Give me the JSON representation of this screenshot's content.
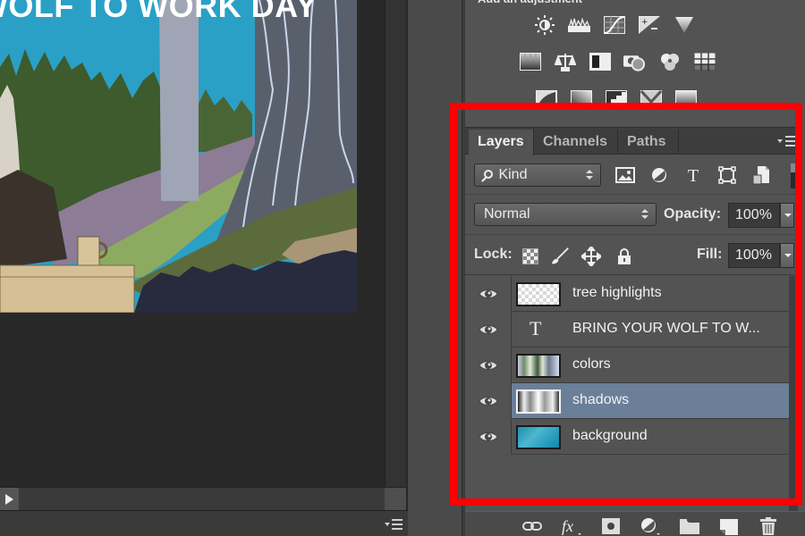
{
  "canvas": {
    "artwork_title": "BRING YOUR WOLF TO WORK DAY",
    "colors": {
      "sky": "#2aa0c6",
      "forest": "#3c5a2c",
      "meadow": "#8fae5f",
      "lilac": "#8a7a94",
      "trunk": "#6b727a",
      "night": "#27283a",
      "paper": "#d8c6a0"
    }
  },
  "status_bar": {
    "menu_icon": "panel-menu-icon"
  },
  "adjustments": {
    "heading": "Add an adjustment",
    "row1": [
      "brightness-contrast-icon",
      "levels-icon",
      "curves-icon",
      "exposure-icon",
      "vibrance-icon"
    ],
    "row2": [
      "hue-saturation-icon",
      "color-balance-icon",
      "black-white-icon",
      "photo-filter-icon",
      "channel-mixer-icon",
      "color-lookup-icon"
    ],
    "row3": [
      "invert-icon",
      "posterize-icon",
      "threshold-icon",
      "selective-color-icon",
      "gradient-map-icon"
    ]
  },
  "layers_panel": {
    "tabs": [
      {
        "label": "Layers",
        "active": true
      },
      {
        "label": "Channels",
        "active": false
      },
      {
        "label": "Paths",
        "active": false
      }
    ],
    "filter": {
      "kind_label": "Kind",
      "icons": [
        "pixel-layer-filter-icon",
        "adjustment-layer-filter-icon",
        "type-layer-filter-icon",
        "shape-layer-filter-icon",
        "smart-object-filter-icon"
      ]
    },
    "blend_mode": "Normal",
    "opacity_label": "Opacity:",
    "opacity_value": "100%",
    "lock_label": "Lock:",
    "fill_label": "Fill:",
    "fill_value": "100%",
    "layers": [
      {
        "name": "tree highlights",
        "type": "pixel",
        "thumb": "transparent",
        "visible": true,
        "selected": false
      },
      {
        "name": "BRING YOUR WOLF TO W...",
        "type": "text",
        "thumb": "T",
        "visible": true,
        "selected": false
      },
      {
        "name": "colors",
        "type": "pixel",
        "thumb": "colors",
        "visible": true,
        "selected": false
      },
      {
        "name": "shadows",
        "type": "pixel",
        "thumb": "shadows",
        "visible": true,
        "selected": true
      },
      {
        "name": "background",
        "type": "pixel",
        "thumb": "background",
        "visible": true,
        "selected": false
      }
    ],
    "bottom_icons": [
      "link-layers-icon",
      "fx-icon",
      "layer-mask-icon",
      "new-adjustment-layer-icon",
      "new-group-icon",
      "new-layer-icon",
      "delete-layer-icon"
    ],
    "selected_color": "#6b7f99"
  },
  "highlight_color": "#ff0000"
}
